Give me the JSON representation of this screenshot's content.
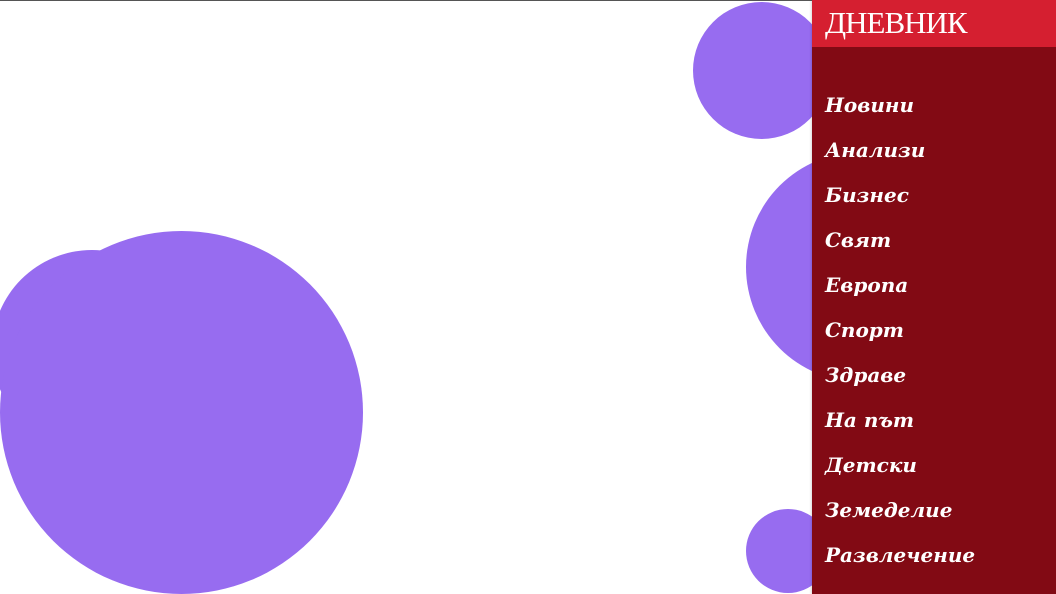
{
  "brand": {
    "title": "ДНЕВНИК"
  },
  "colors": {
    "background": "#ffffff",
    "blob": "#976cf0",
    "brand_bar": "#d51f30",
    "sidebar": "#820a14",
    "text": "#ffffff"
  },
  "navigation": {
    "items": [
      {
        "label": "Новини"
      },
      {
        "label": "Анализи"
      },
      {
        "label": "Бизнес"
      },
      {
        "label": "Свят"
      },
      {
        "label": "Европа"
      },
      {
        "label": "Спорт"
      },
      {
        "label": "Здраве"
      },
      {
        "label": "На път"
      },
      {
        "label": "Детски"
      },
      {
        "label": "Земеделие"
      },
      {
        "label": "Развлечение"
      }
    ]
  }
}
